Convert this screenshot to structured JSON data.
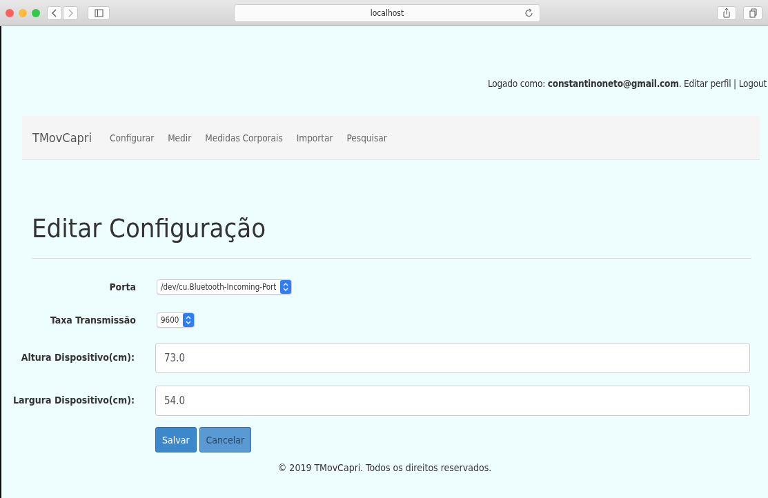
{
  "browser": {
    "address": "localhost"
  },
  "header": {
    "login_label": "Logado como: ",
    "user_email": "constantinoneto@gmail.com",
    "separator_after_email": ". ",
    "edit_profile_link": "Editar perfil",
    "separator": " | ",
    "logout_link": "Logout"
  },
  "navbar": {
    "brand": "TMovCapri",
    "items": [
      {
        "label": "Configurar"
      },
      {
        "label": "Medir"
      },
      {
        "label": "Medidas Corporais"
      },
      {
        "label": "Importar"
      },
      {
        "label": "Pesquisar"
      }
    ]
  },
  "page_title": "Editar Configuração",
  "form": {
    "fields": [
      {
        "kind": "select",
        "label": "Porta",
        "value": "/dev/cu.Bluetooth-Incoming-Port"
      },
      {
        "kind": "select",
        "label": "Taxa Transmissão",
        "value": "9600"
      },
      {
        "kind": "text",
        "label": "Altura Dispositivo(cm):",
        "value": "73.0"
      },
      {
        "kind": "text",
        "label": "Largura Dispositivo(cm):",
        "value": "54.0"
      }
    ],
    "buttons": [
      {
        "label": "Salvar",
        "disabled": false
      },
      {
        "label": "Cancelar",
        "disabled": true
      }
    ]
  },
  "footer": "© 2019 TMovCapri. Todos os direitos reservados."
}
